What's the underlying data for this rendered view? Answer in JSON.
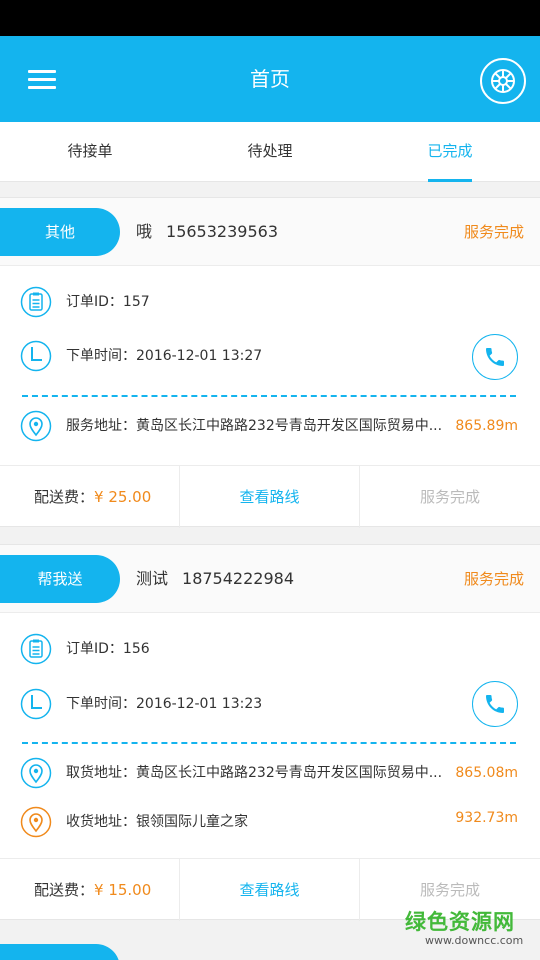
{
  "app_bar": {
    "title": "首页"
  },
  "tabs": [
    {
      "label": "待接单",
      "active": false
    },
    {
      "label": "待处理",
      "active": false
    },
    {
      "label": "已完成",
      "active": true
    }
  ],
  "orders": [
    {
      "type": "其他",
      "customer_name": "哦",
      "customer_phone": "15653239563",
      "status": "服务完成",
      "order_id": "订单ID：157",
      "order_time": "下单时间：2016-12-01 13:27",
      "address": "服务地址：黄岛区长江中路路232号青岛开发区国际贸易中...",
      "address_distance": "865.89m",
      "fee_label": "配送费：",
      "fee": "¥ 25.00",
      "route_label": "查看路线",
      "done_label": "服务完成"
    },
    {
      "type": "帮我送",
      "customer_name": "测试",
      "customer_phone": "18754222984",
      "status": "服务完成",
      "order_id": "订单ID：156",
      "order_time": "下单时间：2016-12-01 13:23",
      "pickup_address": "取货地址：黄岛区长江中路路232号青岛开发区国际贸易中...",
      "pickup_distance": "865.08m",
      "delivery_address": "收货地址：银领国际儿童之家",
      "delivery_distance": "932.73m",
      "fee_label": "配送费：",
      "fee": "¥ 15.00",
      "route_label": "查看路线",
      "done_label": "服务完成"
    }
  ],
  "watermark": {
    "name": "绿色资源网",
    "url": "www.downcc.com"
  },
  "colors": {
    "primary": "#14b4ee",
    "accent": "#f08a1c",
    "muted": "#bbbbbb"
  }
}
